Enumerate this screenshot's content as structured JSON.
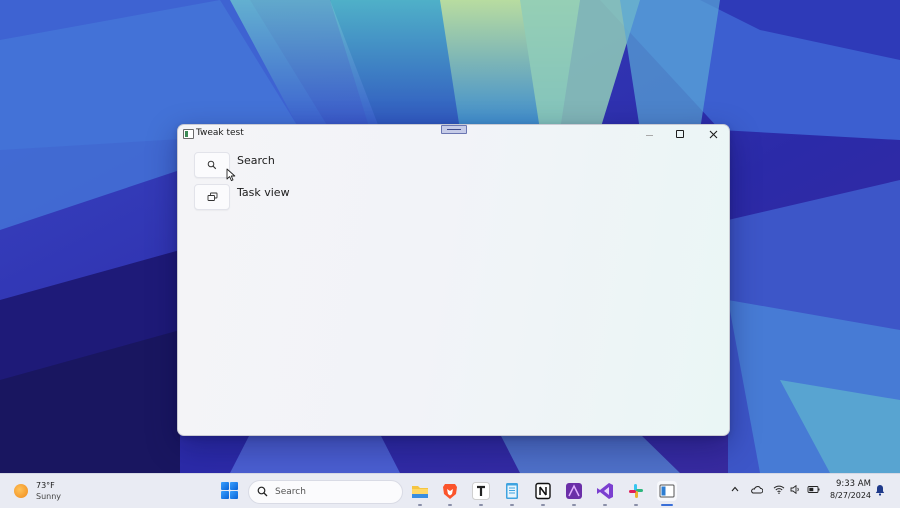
{
  "window": {
    "title": "Tweak test",
    "actions": [
      {
        "label": "Search",
        "icon": "search-icon"
      },
      {
        "label": "Task view",
        "icon": "task-view-icon"
      }
    ]
  },
  "taskbar": {
    "weather": {
      "temperature": "73°F",
      "condition": "Sunny",
      "icon": "sun-icon"
    },
    "search": {
      "placeholder": "Search"
    },
    "apps": [
      {
        "name": "file-explorer",
        "running": true
      },
      {
        "name": "brave-browser",
        "running": true
      },
      {
        "name": "typora",
        "running": true
      },
      {
        "name": "notepad",
        "running": true
      },
      {
        "name": "notion",
        "running": true
      },
      {
        "name": "affinity-designer",
        "running": true
      },
      {
        "name": "visual-studio",
        "running": true
      },
      {
        "name": "slack",
        "running": true
      },
      {
        "name": "tweak-test",
        "running": true,
        "active": true
      }
    ],
    "tray": {
      "icons": [
        "chevron-up-icon",
        "onedrive-cloud-icon",
        "wifi-icon",
        "volume-icon",
        "battery-icon"
      ],
      "time": "9:33 AM",
      "date": "8/27/2024",
      "notification_icon": "bell-icon"
    }
  },
  "colors": {
    "accent": "#3a6fd8",
    "taskbar_bg": "#e9ebf3",
    "window_bg": "#f2f3f8"
  }
}
